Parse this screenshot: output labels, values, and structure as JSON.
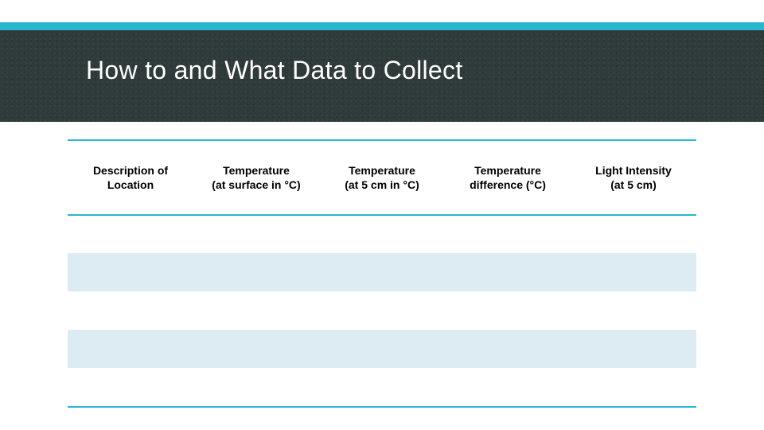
{
  "header": {
    "title": "How to and What Data to Collect"
  },
  "colors": {
    "accent": "#2bb6cf",
    "tint_row": "#dcecf2",
    "chalkboard": "#2f3a3a"
  },
  "table": {
    "columns": [
      {
        "line1": "Description of",
        "line2": "Location"
      },
      {
        "line1": "Temperature",
        "line2": "(at surface in °C)"
      },
      {
        "line1": "Temperature",
        "line2": "(at 5 cm in °C)"
      },
      {
        "line1": "Temperature",
        "line2": "difference (°C)"
      },
      {
        "line1": "Light Intensity",
        "line2": "(at 5 cm)"
      }
    ],
    "rows": [
      [
        "",
        "",
        "",
        "",
        ""
      ],
      [
        "",
        "",
        "",
        "",
        ""
      ],
      [
        "",
        "",
        "",
        "",
        ""
      ],
      [
        "",
        "",
        "",
        "",
        ""
      ],
      [
        "",
        "",
        "",
        "",
        ""
      ]
    ]
  }
}
